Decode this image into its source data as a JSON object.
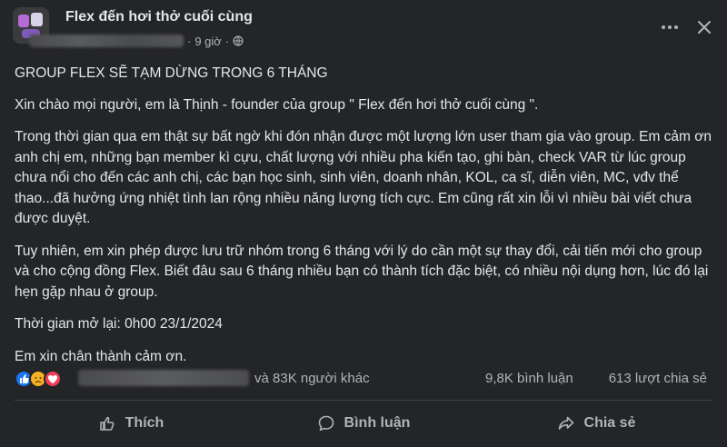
{
  "post": {
    "group_name": "Flex đến hơi thở cuối cùng",
    "time": "9 giờ",
    "separator": "·",
    "icons": {
      "privacy": "globe-icon",
      "more": "more-icon",
      "close": "close-icon"
    }
  },
  "content": {
    "title": "GROUP FLEX SẼ TẠM DỪNG TRONG 6 THÁNG",
    "p1": "Xin chào mọi người, em là Thịnh - founder của group \" Flex đến hơi thở cuối cùng \".",
    "p2": "Trong thời gian qua em thật sự bất ngờ khi đón nhận được một lượng lớn user tham gia vào group. Em cảm ơn anh chị em, những bạn member kì cựu, chất lượng với nhiều pha kiến tạo, ghi bàn, check VAR từ lúc group chưa nổi cho đến các anh chị, các bạn học sinh, sinh viên, doanh nhân, KOL, ca sĩ, diễn viên, MC, vđv thể thao...đã hưởng ứng nhiệt tình lan rộng nhiều năng lượng tích cực. Em cũng rất xin lỗi vì nhiều bài viết chưa được duyệt.",
    "p3": "Tuy nhiên, em xin phép được lưu trữ nhóm trong 6 tháng với lý do cần một sự thay đổi, cải tiến mới cho group và cho cộng đồng Flex. Biết đâu sau 6 tháng nhiều bạn có thành tích đặc biệt, có nhiều nội dụng hơn, lúc đó lại hẹn gặp nhau ở group.",
    "p4": "Thời gian mở lại: 0h00 23/1/2024",
    "p5": "Em xin chân thành cảm ơn."
  },
  "stats": {
    "reaction_icons": [
      "like-icon",
      "sad-icon",
      "love-icon"
    ],
    "reactions_text": "và 83K người khác",
    "comments_text": "9,8K bình luận",
    "shares_text": "613 lượt chia sẻ"
  },
  "actions": {
    "like_label": "Thích",
    "comment_label": "Bình luận",
    "share_label": "Chia sẻ"
  },
  "colors": {
    "background": "#242526",
    "text_primary": "#e4e6eb",
    "text_secondary": "#b0b3b8",
    "like_blue": "#1877f2",
    "sad_yellow": "#f7b125",
    "love_red": "#f33e58"
  }
}
